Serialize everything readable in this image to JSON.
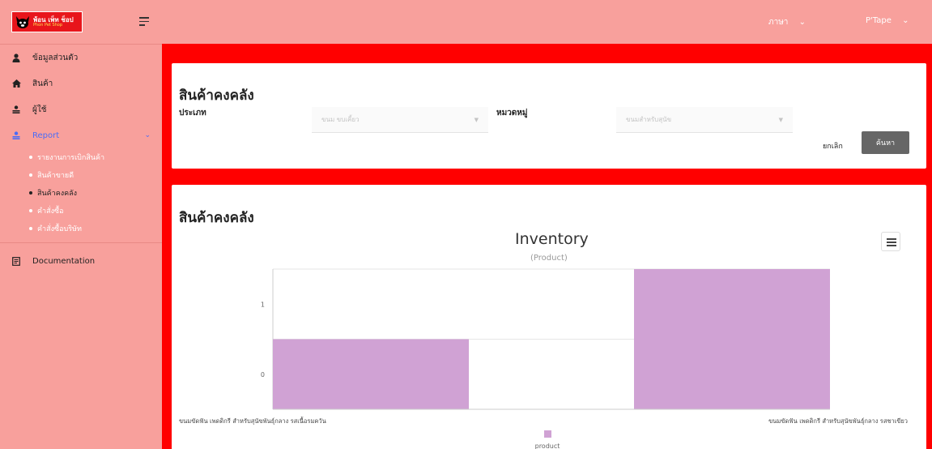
{
  "brand": {
    "logo_main": "พ้อน เพ็ท ช็อป",
    "logo_sub": "Phon Pet Shop"
  },
  "topbar": {
    "language": "ภาษา",
    "user": "P'Tape"
  },
  "sidebar": {
    "items": [
      {
        "label": "ข้อมูลส่วนตัว",
        "icon": "user-icon"
      },
      {
        "label": "สินค้า",
        "icon": "home-icon"
      },
      {
        "label": "ผู้ใช้",
        "icon": "user-icon"
      },
      {
        "label": "Report",
        "icon": "user-icon"
      },
      {
        "label": "Documentation",
        "icon": "document-icon"
      }
    ],
    "report_sub": [
      {
        "label": "รายงานการเบิกสินค้า"
      },
      {
        "label": "สินค้าขายดี"
      },
      {
        "label": "สินค้าคงคลัง"
      },
      {
        "label": "คำสั่งซื้อ"
      },
      {
        "label": "คำสั่งซื้อบริษัท"
      }
    ]
  },
  "filter": {
    "title": "สินค้าคงคลัง",
    "type_label": "ประเภท",
    "type_value": "ขนม ขบเคี้ยว",
    "category_label": "หมวดหมู่",
    "category_value": "ขนมสำหรับสุนัข",
    "cancel_label": "ยกเลิก",
    "search_label": "ค้นหา"
  },
  "report": {
    "title": "สินค้าคงคลัง"
  },
  "chart_data": {
    "type": "bar",
    "title": "Inventory",
    "subtitle": "(Product)",
    "categories": [
      "ขนมขัดฟัน เพดดิกรี สำหรับสุนัขพันธุ์กลาง รสเนื้อรมควัน",
      "ขนมขัดฟัน เพดดิกรี สำหรับสุนัขพันธุ์กลาง รสชาเขียว"
    ],
    "series": [
      {
        "name": "product",
        "values": [
          0.5,
          1.5
        ],
        "color": "#d0a2d4"
      }
    ],
    "y_ticks": [
      0,
      1
    ],
    "ylim": [
      -0.5,
      1.5
    ],
    "grid": true,
    "legend": "bottom"
  }
}
